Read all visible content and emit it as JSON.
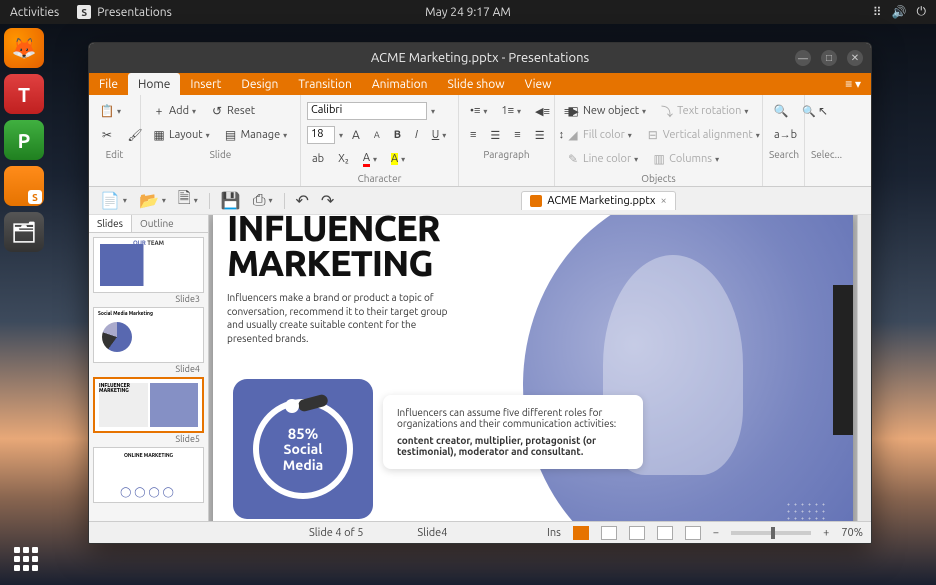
{
  "topbar": {
    "activities": "Activities",
    "app": "Presentations",
    "clock": "May 24  9:17 AM"
  },
  "launcher": {
    "items": [
      "firefox",
      "textmaker",
      "planmaker",
      "presentations",
      "files"
    ]
  },
  "window": {
    "title": "ACME Marketing.pptx - Presentations",
    "menus": {
      "file": "File",
      "home": "Home",
      "insert": "Insert",
      "design": "Design",
      "transition": "Transition",
      "animation": "Animation",
      "slideshow": "Slide show",
      "view": "View"
    },
    "ribbon": {
      "edit": {
        "label": "Edit"
      },
      "slide": {
        "label": "Slide",
        "add": "Add",
        "reset": "Reset",
        "layout": "Layout",
        "manage": "Manage"
      },
      "character": {
        "label": "Character",
        "font": "Calibri",
        "size": "18"
      },
      "paragraph": {
        "label": "Paragraph"
      },
      "objects": {
        "label": "Objects",
        "newobj": "New object",
        "textrot": "Text rotation",
        "fill": "Fill color",
        "valign": "Vertical alignment",
        "line": "Line color",
        "cols": "Columns"
      },
      "search": {
        "label": "Search"
      },
      "selection": {
        "label": "Selec..."
      }
    },
    "tab": {
      "name": "ACME Marketing.pptx"
    },
    "sidepanel": {
      "tab_slides": "Slides",
      "tab_outline": "Outline",
      "thumbs": [
        {
          "label": "Slide3",
          "kind": "team",
          "title": "OUR TEAM"
        },
        {
          "label": "Slide4",
          "kind": "pie",
          "title": "Social Media Marketing"
        },
        {
          "label": "Slide5",
          "kind": "inf",
          "title": "INFLUENCER MARKETING",
          "selected": true
        },
        {
          "label": "",
          "kind": "online",
          "title": "ONLINE MARKETING"
        }
      ]
    },
    "slide": {
      "title_l1": "INFLUENCER",
      "title_l2": "MARKETING",
      "desc": "Influencers make a brand or product a topic of conversation, recommend it to their target group and usually create suitable content for the presented brands.",
      "badge_pct": "85%",
      "badge_lbl1": "Social",
      "badge_lbl2": "Media",
      "callout1": "Influencers can assume five different roles for organizations and their communication activities:",
      "callout2": "content creator, multiplier, protagonist (or testimonial), moderator and consultant."
    },
    "status": {
      "pos": "Slide 4 of 5",
      "name": "Slide4",
      "mode": "Ins",
      "zoom": "70%"
    }
  }
}
